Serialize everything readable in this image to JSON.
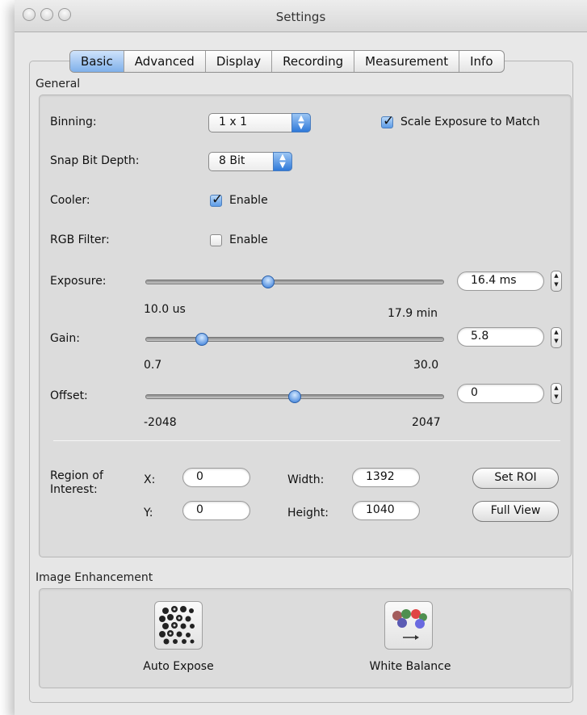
{
  "window": {
    "title": "Settings"
  },
  "tabs": [
    {
      "label": "Basic",
      "active": true
    },
    {
      "label": "Advanced"
    },
    {
      "label": "Display"
    },
    {
      "label": "Recording"
    },
    {
      "label": "Measurement"
    },
    {
      "label": "Info"
    }
  ],
  "general": {
    "title": "General",
    "binning": {
      "label": "Binning:",
      "value": "1 x 1"
    },
    "scale_exposure": {
      "label": "Scale Exposure to Match",
      "checked": true
    },
    "snap_bit_depth": {
      "label": "Snap Bit Depth:",
      "value": "8 Bit"
    },
    "cooler": {
      "label": "Cooler:",
      "checkbox_label": "Enable",
      "checked": true
    },
    "rgb_filter": {
      "label": "RGB Filter:",
      "checkbox_label": "Enable",
      "checked": false
    },
    "exposure": {
      "label": "Exposure:",
      "value": "16.4 ms",
      "min": "10.0 us",
      "max": "17.9 min",
      "slider_fraction": 0.41
    },
    "gain": {
      "label": "Gain:",
      "value": "5.8",
      "min": "0.7",
      "max": "30.0",
      "slider_fraction": 0.19
    },
    "offset": {
      "label": "Offset:",
      "value": "0",
      "min": "-2048",
      "max": "2047",
      "slider_fraction": 0.5
    },
    "roi": {
      "label_line1": "Region of",
      "label_line2": "Interest:",
      "x_label": "X:",
      "x_value": "0",
      "y_label": "Y:",
      "y_value": "0",
      "width_label": "Width:",
      "width_value": "1392",
      "height_label": "Height:",
      "height_value": "1040",
      "set_roi_label": "Set ROI",
      "full_view_label": "Full View"
    }
  },
  "image_enhancement": {
    "title": "Image Enhancement",
    "auto_expose_label": "Auto Expose",
    "white_balance_label": "White Balance"
  },
  "colors": {
    "accent": "#2f79d9",
    "window_bg": "#e8e8e8"
  }
}
